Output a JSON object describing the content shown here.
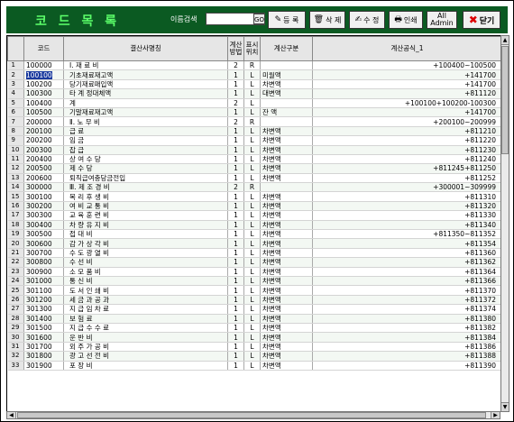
{
  "window": {
    "title": "코 드 목 록"
  },
  "search": {
    "label": "이름검색",
    "value": "",
    "go_label": "GO"
  },
  "toolbar": {
    "buttons": [
      {
        "name": "register-button",
        "icon": "✎",
        "label": "등 록"
      },
      {
        "name": "delete-button",
        "icon": "🗑",
        "label": "삭 제"
      },
      {
        "name": "edit-button",
        "icon": "✍",
        "label": "수 정"
      },
      {
        "name": "print-button",
        "icon": "🖶",
        "label": "인쇄"
      },
      {
        "name": "all-admin-button",
        "icon": "",
        "label": "All",
        "label2": "Admin"
      },
      {
        "name": "close-button",
        "icon": "✖",
        "label": "닫기"
      }
    ]
  },
  "table": {
    "headers": [
      "",
      "코드",
      "결산사명칭",
      "계산\n방법",
      "표시\n위치",
      "계산구분",
      "계산공식_1"
    ],
    "rows": [
      {
        "n": "1",
        "code": "100000",
        "name": "Ⅰ. 재       료       비",
        "calc": "2",
        "pos": "R",
        "type": "",
        "formula": "+100400~100500"
      },
      {
        "n": "2",
        "code": "100100",
        "name": "기초재료재고액",
        "calc": "1",
        "pos": "L",
        "type": "미월액",
        "formula": "+141700"
      },
      {
        "n": "3",
        "code": "100200",
        "name": "당기재료매입액",
        "calc": "1",
        "pos": "L",
        "type": "차변액",
        "formula": "+141700"
      },
      {
        "n": "4",
        "code": "100300",
        "name": "타 계 정대체액",
        "calc": "1",
        "pos": "L",
        "type": "대변액",
        "formula": "+811120"
      },
      {
        "n": "5",
        "code": "100400",
        "name": "계",
        "calc": "2",
        "pos": "L",
        "type": "",
        "formula": "+100100+100200-100300"
      },
      {
        "n": "6",
        "code": "100500",
        "name": "기말재료재고액",
        "calc": "1",
        "pos": "L",
        "type": "잔  액",
        "formula": "+141700"
      },
      {
        "n": "7",
        "code": "200000",
        "name": "Ⅱ. 노       무       비",
        "calc": "2",
        "pos": "R",
        "type": "",
        "formula": "+200100~200999"
      },
      {
        "n": "8",
        "code": "200100",
        "name": "급                    료",
        "calc": "1",
        "pos": "L",
        "type": "차변액",
        "formula": "+811210"
      },
      {
        "n": "9",
        "code": "200200",
        "name": "임                    금",
        "calc": "1",
        "pos": "L",
        "type": "차변액",
        "formula": "+811220"
      },
      {
        "n": "10",
        "code": "200300",
        "name": "잡                    급",
        "calc": "1",
        "pos": "L",
        "type": "차변액",
        "formula": "+811230"
      },
      {
        "n": "11",
        "code": "200400",
        "name": "상   여   수   당",
        "calc": "1",
        "pos": "L",
        "type": "차변액",
        "formula": "+811240"
      },
      {
        "n": "12",
        "code": "200500",
        "name": "제         수         당",
        "calc": "1",
        "pos": "L",
        "type": "차변액",
        "formula": "+811245+811250"
      },
      {
        "n": "13",
        "code": "200600",
        "name": "퇴직급여충당금전입",
        "calc": "1",
        "pos": "L",
        "type": "차변액",
        "formula": "+811252"
      },
      {
        "n": "14",
        "code": "300000",
        "name": "Ⅲ. 제       조       경       비",
        "calc": "2",
        "pos": "R",
        "type": "",
        "formula": "+300001~309999"
      },
      {
        "n": "15",
        "code": "300100",
        "name": "복   리   후   생   비",
        "calc": "1",
        "pos": "L",
        "type": "차변액",
        "formula": "+811310"
      },
      {
        "n": "16",
        "code": "300200",
        "name": "여   비   교   통   비",
        "calc": "1",
        "pos": "L",
        "type": "차변액",
        "formula": "+811320"
      },
      {
        "n": "17",
        "code": "300300",
        "name": "교   육   훈   련   비",
        "calc": "1",
        "pos": "L",
        "type": "차변액",
        "formula": "+811330"
      },
      {
        "n": "18",
        "code": "300400",
        "name": "차   량   유   지   비",
        "calc": "1",
        "pos": "L",
        "type": "차변액",
        "formula": "+811340"
      },
      {
        "n": "19",
        "code": "300500",
        "name": "접         대         비",
        "calc": "1",
        "pos": "L",
        "type": "차변액",
        "formula": "+811350~811352"
      },
      {
        "n": "20",
        "code": "300600",
        "name": "감   가   상   각   비",
        "calc": "1",
        "pos": "L",
        "type": "차변액",
        "formula": "+811354"
      },
      {
        "n": "21",
        "code": "300700",
        "name": "수   도   광   열   비",
        "calc": "1",
        "pos": "L",
        "type": "차변액",
        "formula": "+811360"
      },
      {
        "n": "22",
        "code": "300800",
        "name": "수         선         비",
        "calc": "1",
        "pos": "L",
        "type": "차변액",
        "formula": "+811362"
      },
      {
        "n": "23",
        "code": "300900",
        "name": "소   모   품   비",
        "calc": "1",
        "pos": "L",
        "type": "차변액",
        "formula": "+811364"
      },
      {
        "n": "24",
        "code": "301000",
        "name": "통         신         비",
        "calc": "1",
        "pos": "L",
        "type": "차변액",
        "formula": "+811366"
      },
      {
        "n": "25",
        "code": "301100",
        "name": "도   서   인   쇄   비",
        "calc": "1",
        "pos": "L",
        "type": "차변액",
        "formula": "+811370"
      },
      {
        "n": "26",
        "code": "301200",
        "name": "세   금   과   공   과",
        "calc": "1",
        "pos": "L",
        "type": "차변액",
        "formula": "+811372"
      },
      {
        "n": "27",
        "code": "301300",
        "name": "지   급   임   차   료",
        "calc": "1",
        "pos": "L",
        "type": "차변액",
        "formula": "+811374"
      },
      {
        "n": "28",
        "code": "301400",
        "name": "보         험         료",
        "calc": "1",
        "pos": "L",
        "type": "차변액",
        "formula": "+811380"
      },
      {
        "n": "29",
        "code": "301500",
        "name": "지   급   수   수   료",
        "calc": "1",
        "pos": "L",
        "type": "차변액",
        "formula": "+811382"
      },
      {
        "n": "30",
        "code": "301600",
        "name": "운         반         비",
        "calc": "1",
        "pos": "L",
        "type": "차변액",
        "formula": "+811384"
      },
      {
        "n": "31",
        "code": "301700",
        "name": "외   주   가   공   비",
        "calc": "1",
        "pos": "L",
        "type": "차변액",
        "formula": "+811386"
      },
      {
        "n": "32",
        "code": "301800",
        "name": "광   고   선   전   비",
        "calc": "1",
        "pos": "L",
        "type": "차변액",
        "formula": "+811388"
      },
      {
        "n": "33",
        "code": "301900",
        "name": "포         장         비",
        "calc": "1",
        "pos": "L",
        "type": "차변액",
        "formula": "+811390"
      }
    ]
  },
  "selected_row": 1
}
